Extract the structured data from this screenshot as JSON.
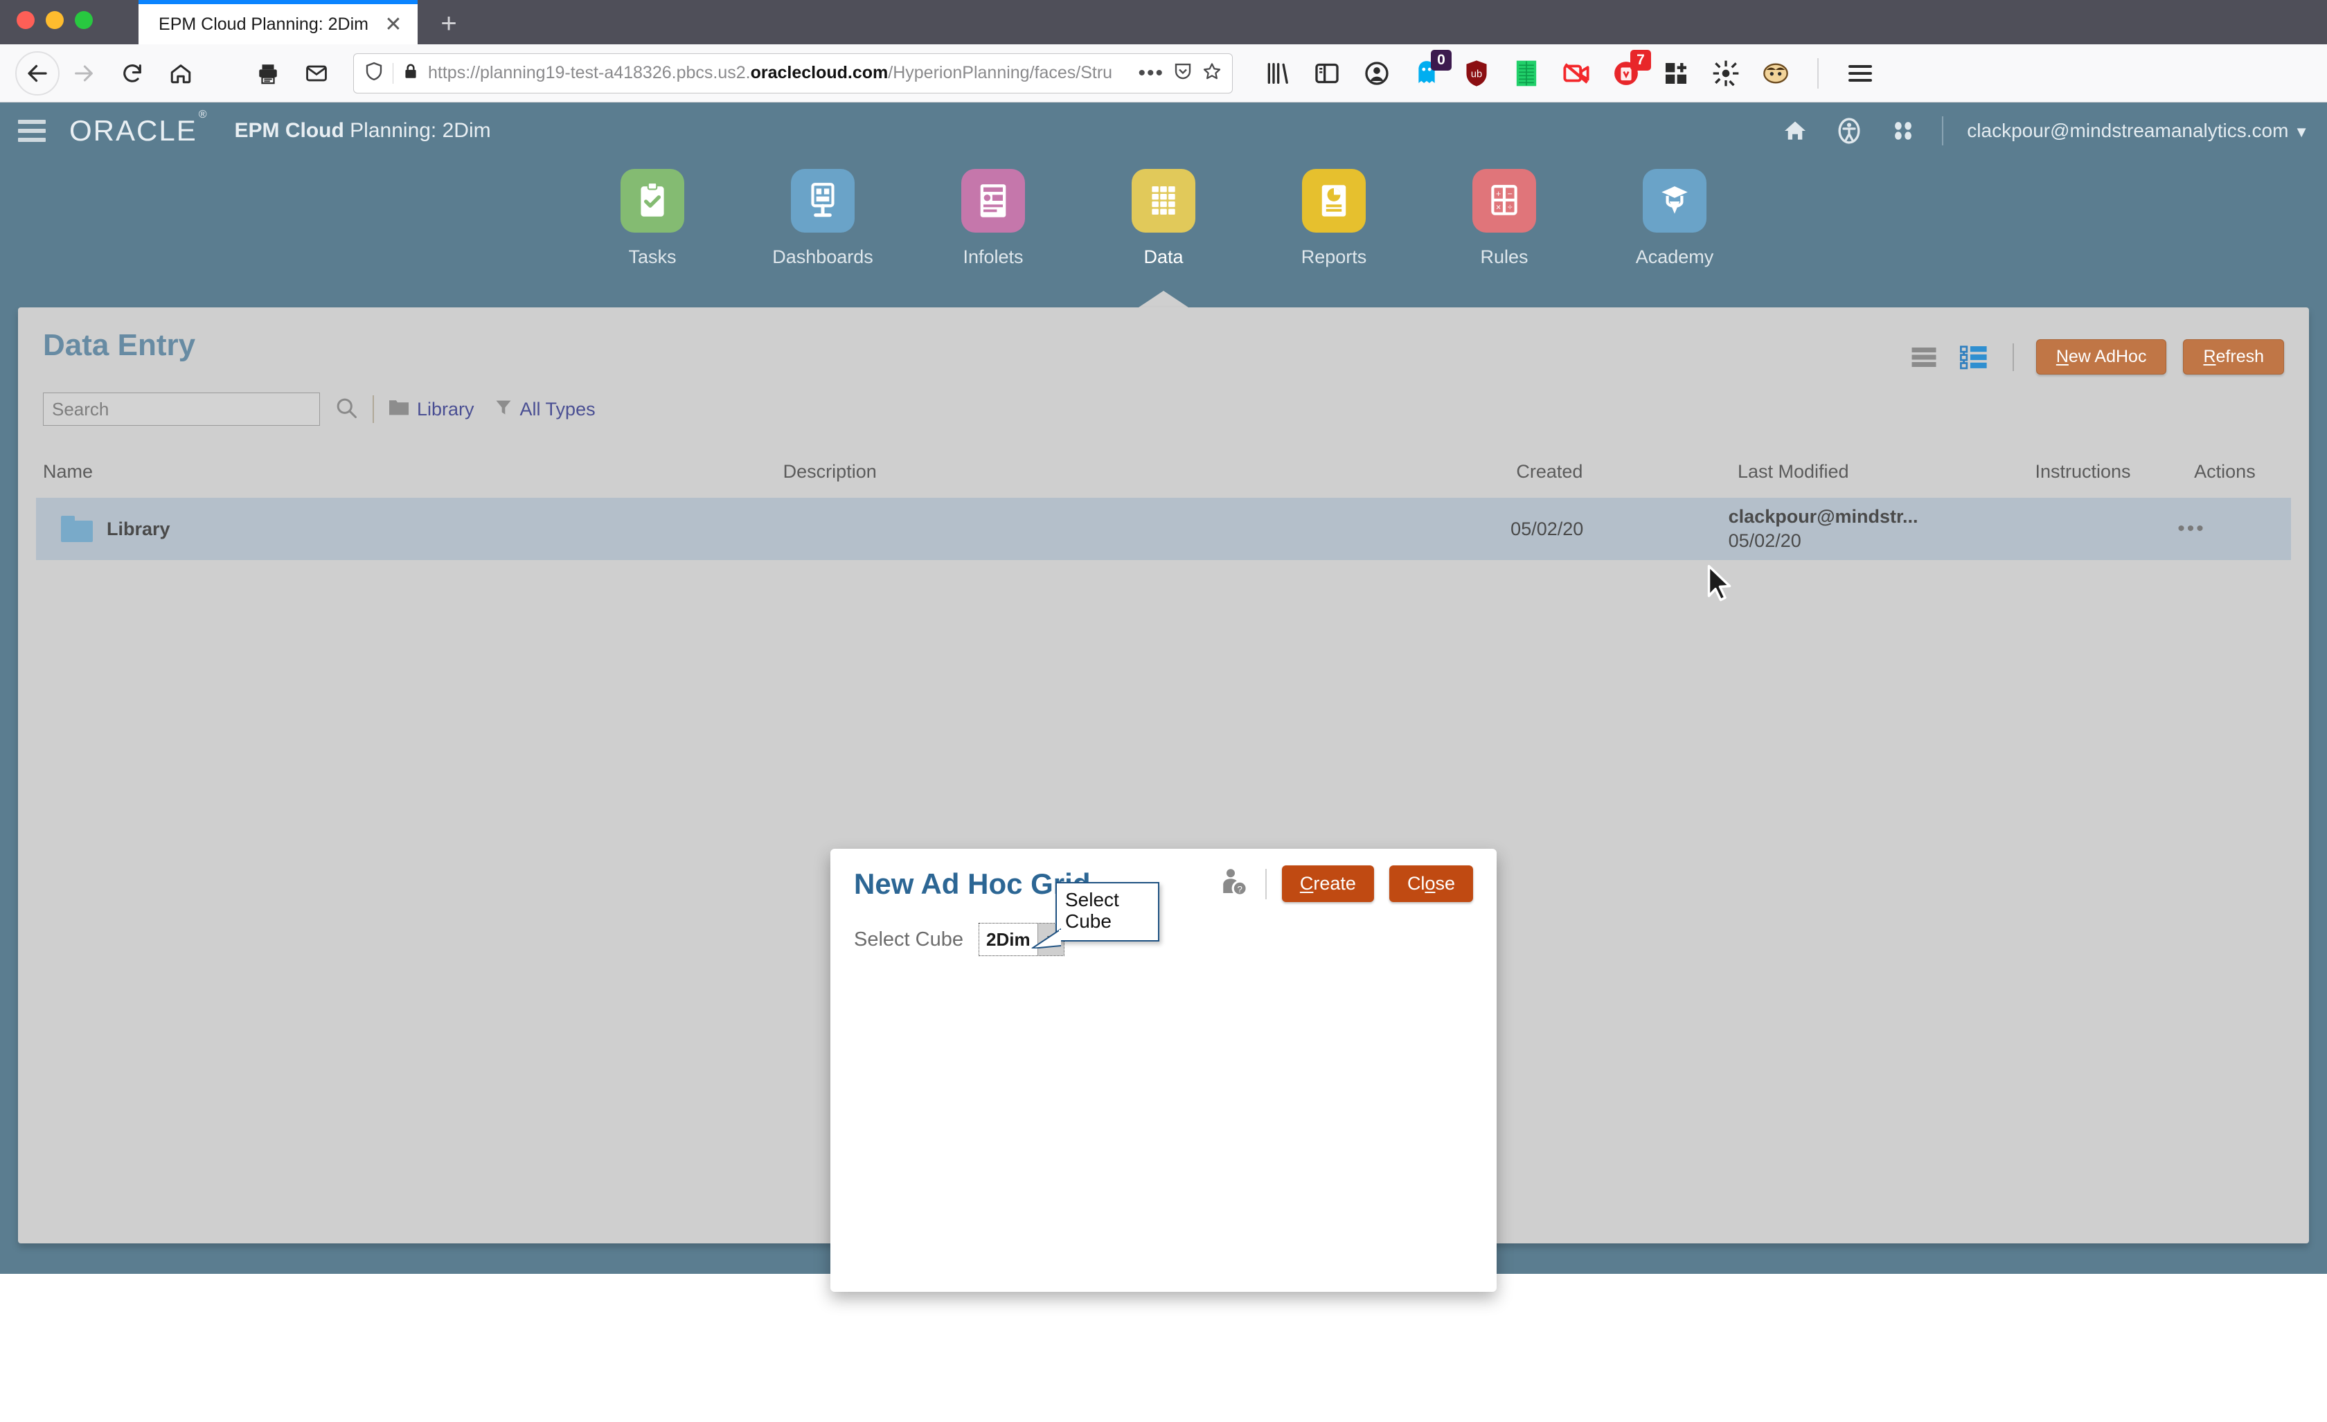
{
  "browser": {
    "tab_title": "EPM Cloud Planning: 2Dim",
    "close_tab_glyph": "✕",
    "new_tab_glyph": "+",
    "url_prefix": "https://planning19-test-a418326.pbcs.us2.",
    "url_domain": "oraclecloud.com",
    "url_suffix": "/HyperionPlanning/faces/Stru",
    "page_actions_glyph": "•••",
    "icons": {
      "back": "back-arrow-icon",
      "forward": "forward-arrow-icon",
      "reload": "reload-icon",
      "home": "home-icon",
      "print": "print-icon",
      "mail": "mail-icon",
      "tracking_shield": "shield-icon",
      "lock": "padlock-icon",
      "pocket": "pocket-icon",
      "bookmark_star": "star-icon",
      "library": "library-icon",
      "sidebar": "sidebar-icon",
      "account": "account-icon",
      "ghostery": "ghostery-icon",
      "ublock": "ublock-origin-icon",
      "green_sheet": "spreadsheet-icon",
      "video_block": "video-blocker-icon",
      "trash_red": "cookie-autodelete-icon",
      "grid_plus": "add-grid-icon",
      "gear": "gear-icon",
      "badger": "privacy-badger-icon",
      "menu": "hamburger-menu-icon"
    },
    "badges": {
      "ghostery_count": "0",
      "cookie_count": "7"
    }
  },
  "app_header": {
    "brand": "ORACLE",
    "brand_mark": "®",
    "title_bold": "EPM Cloud ",
    "title_rest": "Planning: 2Dim",
    "user_email": "clackpour@mindstreamanalytics.com",
    "user_caret": "▼",
    "icons": {
      "menu": "hamburger-menu-icon",
      "home": "home-icon",
      "accessibility": "accessibility-icon",
      "apps": "app-switcher-icon"
    }
  },
  "nav_cards": [
    {
      "label": "Tasks",
      "color": "#84bb72",
      "icon": "clipboard-check-icon",
      "active": false
    },
    {
      "label": "Dashboards",
      "color": "#6aa3c8",
      "icon": "dashboard-icon",
      "active": false
    },
    {
      "label": "Infolets",
      "color": "#c577ab",
      "icon": "infolet-icon",
      "active": false
    },
    {
      "label": "Data",
      "color": "#e1c95a",
      "icon": "grid-icon",
      "active": true
    },
    {
      "label": "Reports",
      "color": "#e6c02e",
      "icon": "report-chart-icon",
      "active": false
    },
    {
      "label": "Rules",
      "color": "#e0757a",
      "icon": "calculator-icon",
      "active": false
    },
    {
      "label": "Academy",
      "color": "#6aa3c8",
      "icon": "graduation-icon",
      "active": false
    }
  ],
  "page": {
    "title": "Data Entry",
    "search_placeholder": "Search",
    "breadcrumb_library": "Library",
    "breadcrumb_filter": "All Types",
    "new_adhoc_label_accel": "N",
    "new_adhoc_label_rest": "ew AdHoc",
    "refresh_label_accel": "R",
    "refresh_label_rest": "efresh",
    "icons": {
      "search": "search-icon",
      "folder": "folder-icon",
      "filter": "funnel-icon",
      "list_view": "list-view-icon",
      "tree_view": "tree-view-icon"
    }
  },
  "table": {
    "columns": [
      "Name",
      "Description",
      "Created",
      "Last Modified",
      "Instructions",
      "Actions"
    ],
    "rows": [
      {
        "name": "Library",
        "description": "",
        "created": "05/02/20",
        "modified_user": "clackpour@mindstr...",
        "modified_date": "05/02/20",
        "instructions": "",
        "actions_glyph": "•••",
        "icon": "folder-icon"
      }
    ]
  },
  "modal": {
    "title": "New Ad Hoc Grid",
    "field_label": "Select Cube",
    "selected_cube": "2Dim",
    "select_caret": "▼",
    "create_accel": "C",
    "create_rest": "reate",
    "close_pre": "Cl",
    "close_accel": "o",
    "close_rest": "se",
    "help_icon": "user-help-icon"
  },
  "tooltip": {
    "text": "Select\nCube"
  },
  "colors": {
    "app_header_bg": "#5b7d90",
    "panel_bg": "#cfcfcf",
    "row_bg": "#b4bfca",
    "title_blue": "#678ba3",
    "modal_title_blue": "#2c6694",
    "button_orange": "#c07646",
    "modal_button_orange": "#c04a12",
    "tooltip_border": "#1e5181",
    "link_blue": "#4a4f93"
  }
}
